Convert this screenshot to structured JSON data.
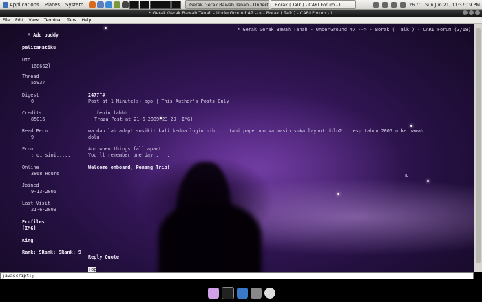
{
  "panel": {
    "menus": [
      "Applications",
      "Places",
      "System"
    ],
    "tasks": [
      "Gerak Gerak Bawah Tanah - UnderGround 47 -->",
      "Borak ( Talk ) - CARI Forum - L..."
    ],
    "temperature": "26 °C",
    "clock": "Sun Jun 21, 11:37:19 PM"
  },
  "window": {
    "title": "* Gerak Gerak Bawah Tanah - UnderGround 47 --> - Borak ( Talk ) - CARI Forum - L",
    "menus": [
      "File",
      "Edit",
      "View",
      "Terminal",
      "Tabs",
      "Help"
    ]
  },
  "page": {
    "header_right": "* Gerak Gerak Bawah Tanah - UnderGround 47 --> - Borak ( Talk ) - CARI Forum (3/18)",
    "add_buddy": "* Add buddy",
    "username": "pelitaHatiku",
    "profile": [
      {
        "label": "UID",
        "value": "168662l"
      },
      {
        "label": "Thread",
        "value": "55937"
      },
      {
        "label": "Digest",
        "value": "0"
      },
      {
        "label": "Credits",
        "value": "85016"
      },
      {
        "label": "Read Perm.",
        "value": "9"
      },
      {
        "label": "From",
        "value": ": di sini....."
      },
      {
        "label": "Online",
        "value": "3868 Hours"
      },
      {
        "label": "Joined",
        "value": "9-13-2006"
      },
      {
        "label": "Last Visit",
        "value": "21-6-2009"
      }
    ],
    "profiles_label": "Profiles",
    "profiles_img": "[IMG]",
    "rank_title": "King",
    "rank_line": "Rank: 9Rank: 9Rank: 9",
    "post_number": "2477^#",
    "post_meta": "Post at 1 Minute(s) ago | This Author's Posts Only",
    "quote_author": "fenin lahhh",
    "quote_meta": "Traza Post at 21-6-2009 23:29 [IMG]",
    "message_line1": "wa dah lah adapt sosikit kali kedua login nih.....tapi pape pun wa masih suka layout dolu2....esp tahun 2005 n ke bawah",
    "message_line2": "dolu",
    "lyric1": "And when things fall apart",
    "lyric2": "You'll remember one day . . .",
    "welcome": "Welcome onboard, Penang Trip!",
    "reply_quote": "Reply Quote",
    "top_link": "Top",
    "status": "javascript:;"
  },
  "colors": {
    "terminal_bg": "#2a1248",
    "text": "#d8d0e8",
    "panel": "#e2e0db"
  }
}
